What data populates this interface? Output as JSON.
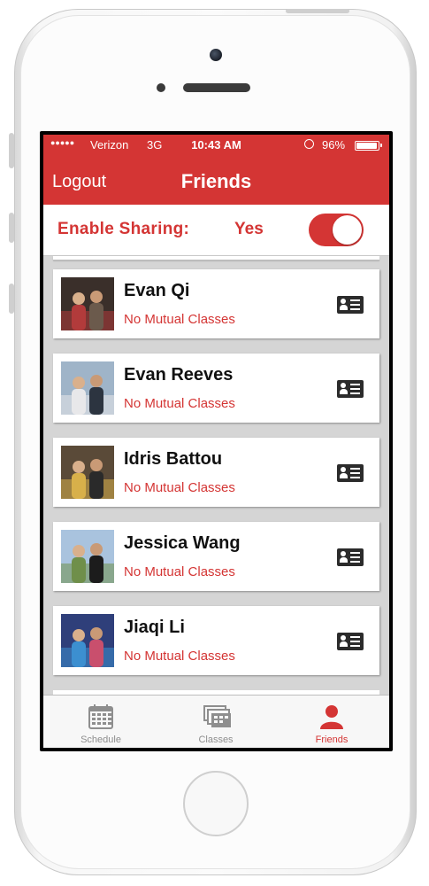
{
  "status_bar": {
    "signal": "●●●●●",
    "carrier": "Verizon",
    "network": "3G",
    "time": "10:43 AM",
    "battery": "96%"
  },
  "nav": {
    "logout_label": "Logout",
    "title": "Friends"
  },
  "sharing": {
    "label": "Enable Sharing:",
    "value": "Yes",
    "enabled": true
  },
  "friends": [
    {
      "name": "Evan Qi",
      "mutual": "No Mutual Classes",
      "photo_colors": [
        "#3a2f2a",
        "#b23b3b",
        "#6b5a4c"
      ]
    },
    {
      "name": "Evan Reeves",
      "mutual": "No Mutual Classes",
      "photo_colors": [
        "#9fb4c8",
        "#e8e8ea",
        "#2c3440"
      ]
    },
    {
      "name": "Idris Battou",
      "mutual": "No Mutual Classes",
      "photo_colors": [
        "#5a4a38",
        "#d8b04a",
        "#2a2a2a"
      ]
    },
    {
      "name": "Jessica Wang",
      "mutual": "No Mutual Classes",
      "photo_colors": [
        "#a9c3de",
        "#6f8f4a",
        "#1c1c1c"
      ]
    },
    {
      "name": "Jiaqi Li",
      "mutual": "No Mutual Classes",
      "photo_colors": [
        "#2f3f7a",
        "#3c8fd0",
        "#c94f6d"
      ]
    }
  ],
  "tabs": [
    {
      "label": "Schedule",
      "icon": "calendar-icon",
      "active": false
    },
    {
      "label": "Classes",
      "icon": "classes-icon",
      "active": false
    },
    {
      "label": "Friends",
      "icon": "person-icon",
      "active": true
    }
  ],
  "colors": {
    "accent": "#d43534",
    "list_background": "#d5d5d5",
    "inactive_tab": "#8e8e8e"
  }
}
